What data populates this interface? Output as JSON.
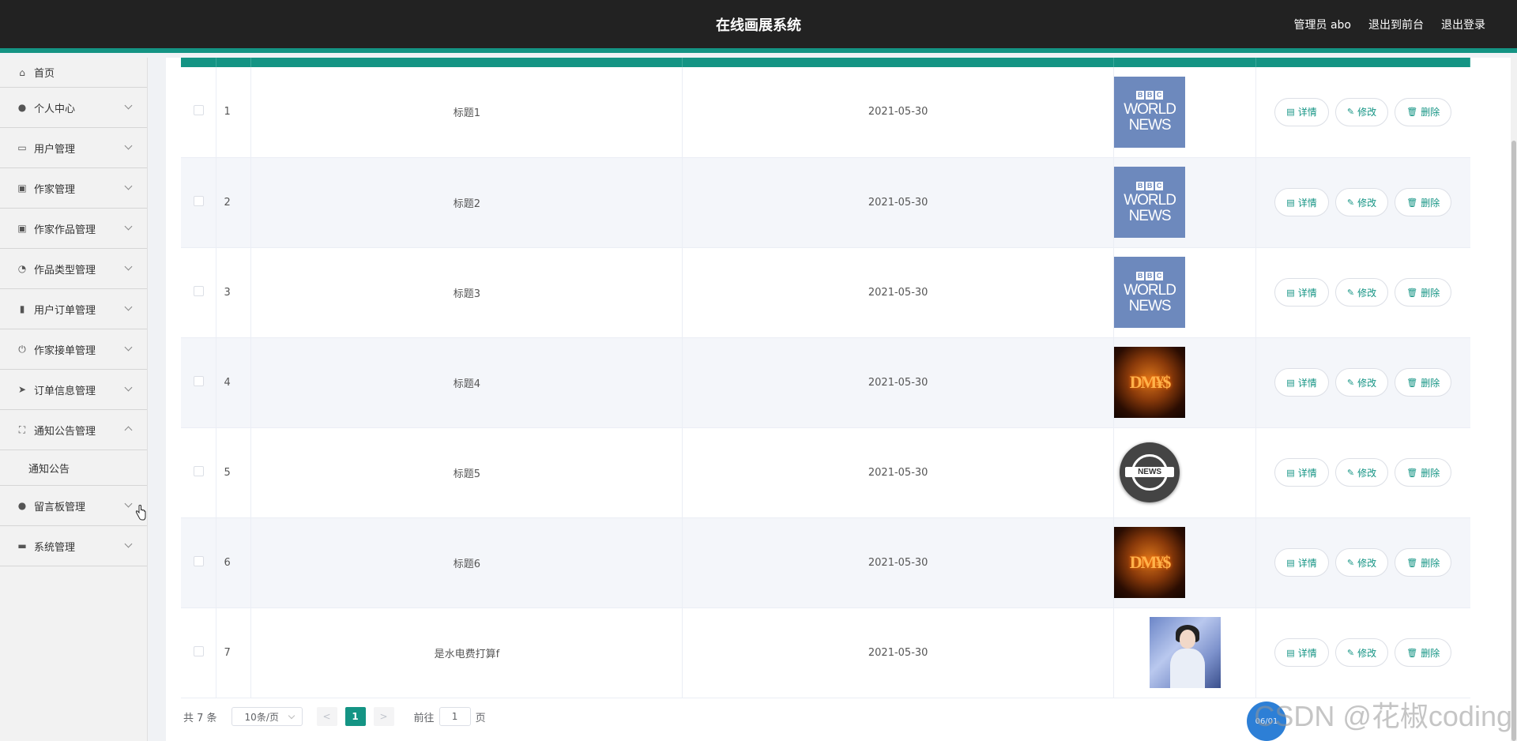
{
  "header": {
    "title": "在线画展系统",
    "links": [
      "管理员 abo",
      "退出到前台",
      "退出登录"
    ]
  },
  "sidebar": {
    "items": [
      {
        "label": "首页",
        "icon": "home-icon"
      },
      {
        "label": "个人中心",
        "icon": "user-icon"
      },
      {
        "label": "用户管理",
        "icon": "id-card-icon"
      },
      {
        "label": "作家管理",
        "icon": "clipboard-icon"
      },
      {
        "label": "作家作品管理",
        "icon": "clipboard-icon"
      },
      {
        "label": "作品类型管理",
        "icon": "gauge-icon"
      },
      {
        "label": "用户订单管理",
        "icon": "bar-chart-icon"
      },
      {
        "label": "作家接单管理",
        "icon": "power-icon"
      },
      {
        "label": "订单信息管理",
        "icon": "send-icon"
      },
      {
        "label": "通知公告管理",
        "icon": "fullscreen-icon"
      },
      {
        "label": "留言板管理",
        "icon": "user-icon"
      },
      {
        "label": "系统管理",
        "icon": "ticket-icon"
      }
    ],
    "submenu_notice": "通知公告"
  },
  "table": {
    "rows": [
      {
        "index": "1",
        "title": "标题1",
        "date": "2021-05-30",
        "image": "bbc-world-news"
      },
      {
        "index": "2",
        "title": "标题2",
        "date": "2021-05-30",
        "image": "bbc-world-news"
      },
      {
        "index": "3",
        "title": "标题3",
        "date": "2021-05-30",
        "image": "bbc-world-news"
      },
      {
        "index": "4",
        "title": "标题4",
        "date": "2021-05-30",
        "image": "dm-currency"
      },
      {
        "index": "5",
        "title": "标题5",
        "date": "2021-05-30",
        "image": "news-globe"
      },
      {
        "index": "6",
        "title": "标题6",
        "date": "2021-05-30",
        "image": "dm-currency"
      },
      {
        "index": "7",
        "title": "是水电费打算f",
        "date": "2021-05-30",
        "image": "portrait"
      }
    ],
    "actions": {
      "detail": "详情",
      "edit": "修改",
      "delete": "删除"
    },
    "bbc_text": {
      "letters": [
        "B",
        "B",
        "C"
      ],
      "line1": "WORLD",
      "line2": "NEWS"
    },
    "news_label": "NEWS",
    "dm_text": "DM¥$"
  },
  "pagination": {
    "total": "共 7 条",
    "page_size": "10条/页",
    "prev": "<",
    "current_page": "1",
    "next": ">",
    "goto_label": "前往",
    "goto_value": "1",
    "page_unit": "页"
  },
  "watermark": "CSDN @花椒coding",
  "badge": "06/01",
  "colors": {
    "accent": "#149484",
    "header_bg": "#222222"
  }
}
